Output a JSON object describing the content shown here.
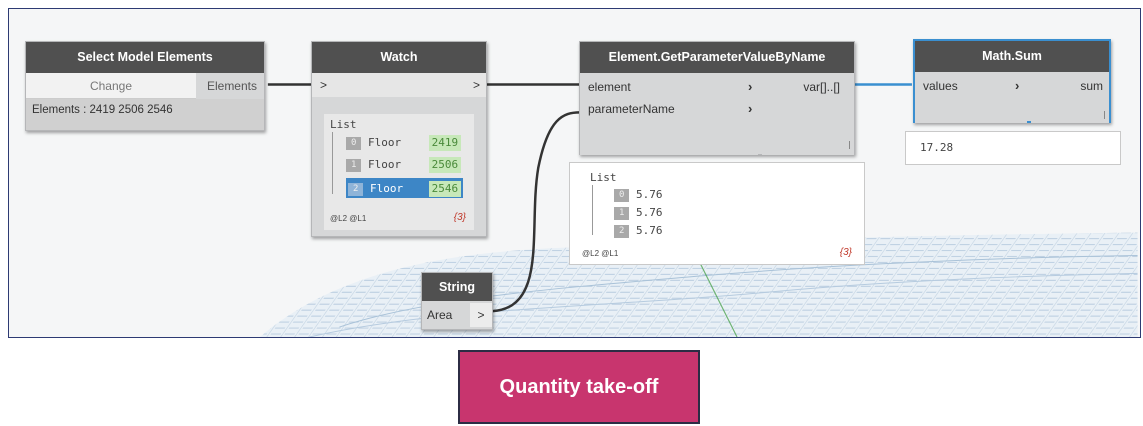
{
  "select_node": {
    "title": "Select Model Elements",
    "change_label": "Change",
    "output_label": "Elements",
    "status": "Elements : 2419 2506 2546"
  },
  "watch_node": {
    "title": "Watch",
    "input_glyph": ">",
    "output_glyph": ">",
    "list_label": "List",
    "items": [
      {
        "index": "0",
        "name": "Floor",
        "value": "2419"
      },
      {
        "index": "1",
        "name": "Floor",
        "value": "2506"
      },
      {
        "index": "2",
        "name": "Floor",
        "value": "2546"
      }
    ],
    "levels": "@L2 @L1",
    "count": "{3}"
  },
  "getparam_node": {
    "title": "Element.GetParameterValueByName",
    "input_element": "element",
    "input_param": "parameterName",
    "output_label": "var[]..[]",
    "preview": {
      "list_label": "List",
      "items": [
        {
          "index": "0",
          "value": "5.76"
        },
        {
          "index": "1",
          "value": "5.76"
        },
        {
          "index": "2",
          "value": "5.76"
        }
      ],
      "levels": "@L2 @L1",
      "count": "{3}"
    }
  },
  "sum_node": {
    "title": "Math.Sum",
    "input_label": "values",
    "output_label": "sum",
    "result": "17.28"
  },
  "string_node": {
    "title": "String",
    "value": "Area",
    "output_glyph": ">"
  },
  "caption": "Quantity take-off",
  "colors": {
    "caption_bg": "#c8356e",
    "header_bg": "#505050",
    "selection": "#3a8fd0",
    "wire": "#333333",
    "wire_selected": "#3a8fd0"
  }
}
